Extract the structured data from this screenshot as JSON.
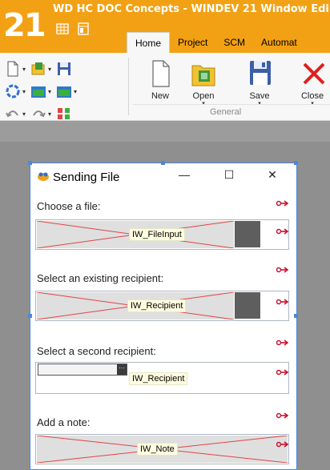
{
  "titlebar": {
    "logo": "21",
    "title": "WD HC DOC Concepts - WINDEV 21  Window Edi"
  },
  "ribbon": {
    "tabs": [
      {
        "label": "Home",
        "active": true
      },
      {
        "label": "Project",
        "active": false
      },
      {
        "label": "SCM",
        "active": false
      },
      {
        "label": "Automat",
        "active": false
      }
    ],
    "buttons": [
      {
        "label": "New",
        "icon": "new-document-icon",
        "has_dropdown": false
      },
      {
        "label": "Open",
        "icon": "open-folder-icon",
        "has_dropdown": true
      },
      {
        "label": "Save",
        "icon": "save-floppy-icon",
        "has_dropdown": true
      },
      {
        "label": "Close",
        "icon": "close-x-icon",
        "has_dropdown": true
      }
    ],
    "group_label": "General",
    "dropdown_glyph": "▾"
  },
  "window": {
    "title": "Sending File",
    "controls": {
      "minimize": "—",
      "maximize": "☐",
      "close": "✕"
    },
    "fields": [
      {
        "label": "Choose a file:",
        "control_name": "IW_FileInput",
        "kind": "file"
      },
      {
        "label": "Select an existing recipient:",
        "control_name": "IW_Recipient",
        "kind": "picker"
      },
      {
        "label": "Select a second recipient:",
        "control_name": "IW_Recipient",
        "kind": "combo",
        "combo_button": "···"
      },
      {
        "label": "Add a note:",
        "control_name": "IW_Note",
        "kind": "note"
      }
    ],
    "anchor_glyph": "→"
  },
  "colors": {
    "titlebar": "#f2a114",
    "ribbon": "#f7f7f7",
    "editor_bg": "#8f8f8f",
    "selection": "#4f86d8",
    "anchor": "#c8102e",
    "hatch_line": "#e04444"
  }
}
